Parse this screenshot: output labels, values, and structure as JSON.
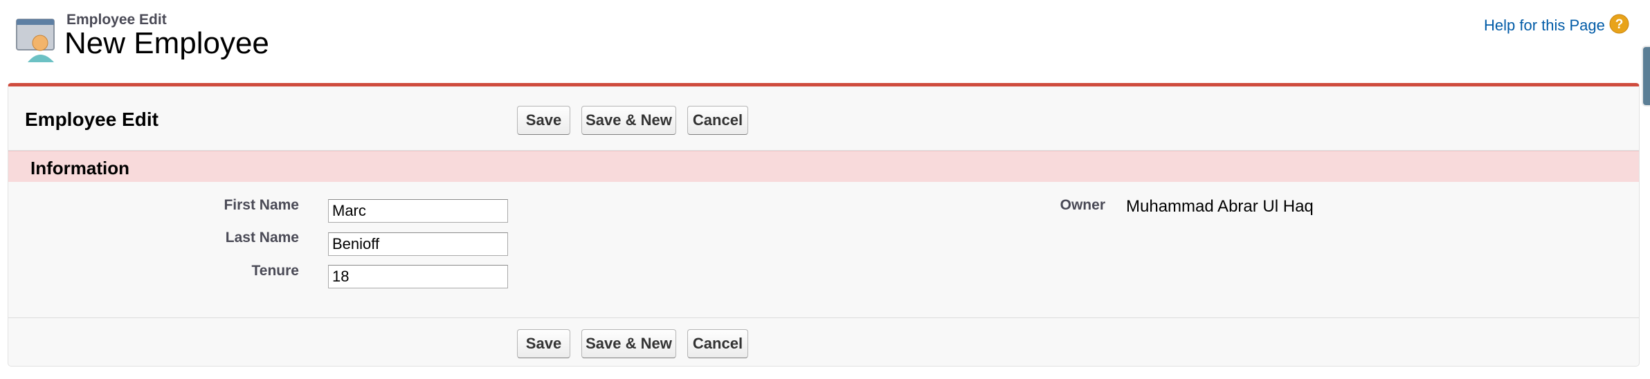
{
  "header": {
    "object_type": "Employee Edit",
    "title": "New Employee",
    "help_link": "Help for this Page",
    "help_icon": "?"
  },
  "edit_block": {
    "title": "Employee Edit",
    "top_buttons": {
      "save": "Save",
      "save_new": "Save & New",
      "cancel": "Cancel"
    },
    "bottom_buttons": {
      "save": "Save",
      "save_new": "Save & New",
      "cancel": "Cancel"
    },
    "section_title": "Information",
    "fields": {
      "first_name": {
        "label": "First Name",
        "value": "Marc"
      },
      "last_name": {
        "label": "Last Name",
        "value": "Benioff"
      },
      "tenure": {
        "label": "Tenure",
        "value": "18"
      },
      "owner": {
        "label": "Owner",
        "value": "Muhammad Abrar Ul Haq"
      }
    }
  },
  "colors": {
    "accent_border": "#cf4c3e",
    "section_bg": "#f8dadb",
    "link": "#015ba7",
    "help_icon": "#e8a31a"
  },
  "icons": {
    "page_icon": "employee-card-icon",
    "help_icon": "help-question-icon"
  }
}
